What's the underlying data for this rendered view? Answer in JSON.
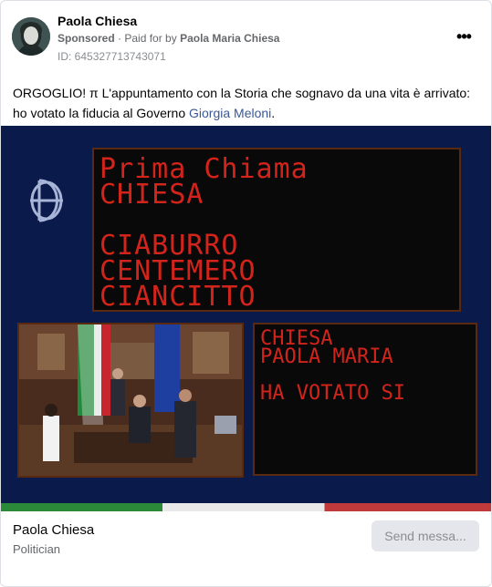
{
  "post": {
    "page_name": "Paola Chiesa",
    "sponsored_label": "Sponsored",
    "paid_for_prefix": "Paid for by",
    "paid_for_by": "Paola Maria Chiesa",
    "ad_id": "ID: 645327713743071",
    "more_icon": "more-horizontal-icon",
    "text_before_link": "ORGOGLIO! π L'appuntamento con la Storia che sognavo da una vita è arrivato: ho votato la fiducia al Governo ",
    "link_text": "Giorgia Meloni",
    "text_after_link": ".",
    "link_color": "#385898"
  },
  "media": {
    "board_main": {
      "line1": "Prima Chiama",
      "line2": "CHIESA",
      "line3": "CIABURRO",
      "line4": "CENTEMERO",
      "line5": "CIANCITTO"
    },
    "board_vote": {
      "line1": "CHIESA",
      "line2": "PAOLA MARIA",
      "line3": "HA VOTATO SI"
    },
    "led_color": "#d3241c"
  },
  "footer": {
    "page_name": "Paola Chiesa",
    "category": "Politician",
    "cta_label": "Send messa..."
  }
}
